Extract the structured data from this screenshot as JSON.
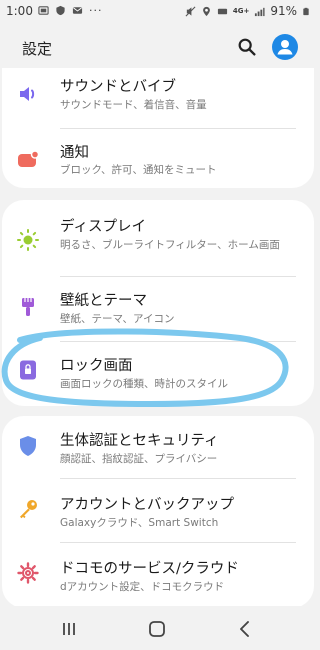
{
  "status_bar": {
    "time": "1:00",
    "battery": "91%",
    "network_label": "4G+"
  },
  "header": {
    "title": "設定"
  },
  "items": [
    {
      "title": "サウンドとバイブ",
      "subtitle": "サウンドモード、着信音、音量"
    },
    {
      "title": "通知",
      "subtitle": "ブロック、許可、通知をミュート"
    },
    {
      "title": "ディスプレイ",
      "subtitle": "明るさ、ブルーライトフィルター、ホーム画面"
    },
    {
      "title": "壁紙とテーマ",
      "subtitle": "壁紙、テーマ、アイコン"
    },
    {
      "title": "ロック画面",
      "subtitle": "画面ロックの種類、時計のスタイル"
    },
    {
      "title": "生体認証とセキュリティ",
      "subtitle": "顔認証、指紋認証、プライバシー"
    },
    {
      "title": "アカウントとバックアップ",
      "subtitle": "Galaxyクラウド、Smart Switch"
    },
    {
      "title": "ドコモのサービス/クラウド",
      "subtitle": "dアカウント設定、ドコモクラウド"
    }
  ],
  "colors": {
    "background": "#f2f2f2",
    "card": "#ffffff",
    "accent_blue": "#1e88e5",
    "highlight_stroke": "#7cc8ee"
  },
  "icons": {
    "sound": "volume-icon",
    "notification": "notification-icon",
    "display": "brightness-icon",
    "wallpaper": "paintbrush-icon",
    "lock": "lock-icon",
    "security": "shield-icon",
    "accounts": "key-icon",
    "docomo": "gear-icon"
  }
}
